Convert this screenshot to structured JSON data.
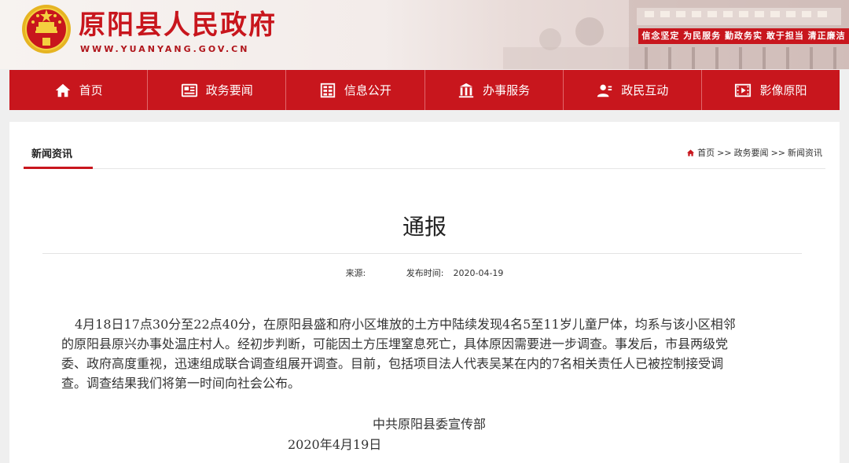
{
  "header": {
    "title": "原阳县人民政府",
    "url": "WWW.YUANYANG.GOV.CN",
    "slogan": "信念坚定 为民服务 勤政务实 敢于担当 清正廉洁",
    "colors": {
      "brand_red": "#c8161d"
    }
  },
  "nav": {
    "items": [
      {
        "label": "首页",
        "icon": "home-icon"
      },
      {
        "label": "政务要闻",
        "icon": "news-icon"
      },
      {
        "label": "信息公开",
        "icon": "info-icon"
      },
      {
        "label": "办事服务",
        "icon": "building-icon"
      },
      {
        "label": "政民互动",
        "icon": "user-icon"
      },
      {
        "label": "影像原阳",
        "icon": "film-icon"
      }
    ]
  },
  "section": {
    "tab": "新闻资讯",
    "breadcrumb": [
      "首页",
      ">>",
      "政务要闻",
      ">>",
      "新闻资讯"
    ]
  },
  "article": {
    "title": "通报",
    "source_label": "来源:",
    "source_value": "",
    "date_label": "发布时间:",
    "date_value": "2020-04-19",
    "body": "4月18日17点30分至22点40分，在原阳县盛和府小区堆放的土方中陆续发现4名5至11岁儿童尸体，均系与该小区相邻的原阳县原兴办事处温庄村人。经初步判断，可能因土方压埋窒息死亡，具体原因需要进一步调查。事发后，市县两级党委、政府高度重视，迅速组成联合调查组展开调查。目前，包括项目法人代表吴某在内的7名相关责任人已被控制接受调查。调查结果我们将第一时间向社会公布。",
    "signature_org": "中共原阳县委宣传部",
    "signature_date": "2020年4月19日"
  }
}
